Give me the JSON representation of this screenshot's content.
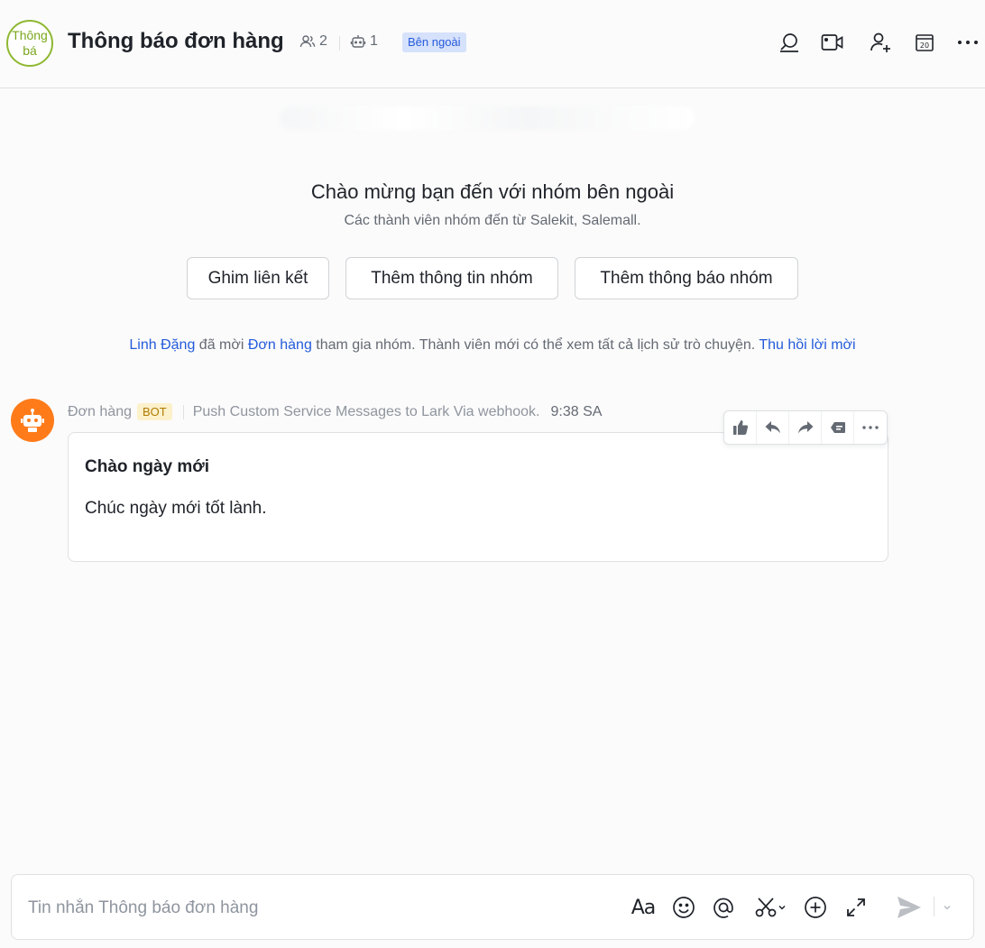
{
  "header": {
    "avatar_text": "Thông bá",
    "title": "Thông báo đơn hàng",
    "member_count": "2",
    "bot_count": "1",
    "external_badge": "Bên ngoài"
  },
  "welcome": {
    "title": "Chào mừng bạn đến với nhóm bên ngoài",
    "subtitle": "Các thành viên nhóm đến từ Salekit, Salemall.",
    "buttons": [
      "Ghim liên kết",
      "Thêm thông tin nhóm",
      "Thêm thông báo nhóm"
    ]
  },
  "system_message": {
    "inviter": "Linh Đặng",
    "text1": " đã mời ",
    "invitee": "Đơn hàng",
    "text2": " tham gia nhóm. Thành viên mới có thể xem tất cả lịch sử trò chuyện. ",
    "action": "Thu hồi lời mời"
  },
  "message": {
    "sender": "Đơn hàng",
    "badge": "BOT",
    "source": "Push Custom Service Messages to Lark Via webhook.",
    "time": "9:38 SA",
    "card_title": "Chào ngày mới",
    "card_text": "Chúc ngày mới tốt lành."
  },
  "composer": {
    "placeholder": "Tin nhắn Thông báo đơn hàng",
    "format_label": "Aa"
  },
  "colors": {
    "accent_blue": "#245bdb",
    "bot_orange": "#ff7b1a",
    "avatar_green": "#8fb832"
  }
}
